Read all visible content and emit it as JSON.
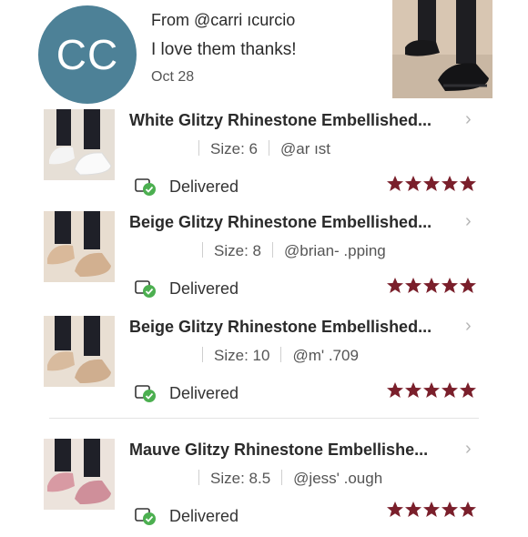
{
  "review": {
    "avatar_initials": "CC",
    "from": "From @carri      ıcurcio",
    "message": "I love them thanks!",
    "date": "Oct 28"
  },
  "orders": [
    {
      "title": "White Glitzy Rhinestone Embellished...",
      "size": "Size: 6",
      "user": "@ar    ıst",
      "status": "Delivered",
      "rating": 5
    },
    {
      "title": "Beige Glitzy Rhinestone Embellished...",
      "size": "Size: 8",
      "user": "@brian-    .pping",
      "status": "Delivered",
      "rating": 5
    },
    {
      "title": "Beige Glitzy Rhinestone Embellished...",
      "size": "Size: 10",
      "user": "@m'    .709",
      "status": "Delivered",
      "rating": 5
    },
    {
      "title": "Mauve Glitzy Rhinestone Embellishe...",
      "size": "Size: 8.5",
      "user": "@jess'    .ough",
      "status": "Delivered",
      "rating": 5
    }
  ],
  "chevron": "›",
  "colors": {
    "avatar_bg": "#4d8197",
    "star": "#7a1f2b",
    "check": "#4caf50"
  }
}
